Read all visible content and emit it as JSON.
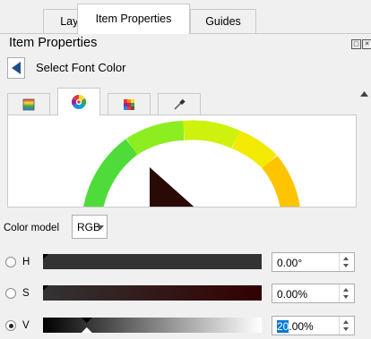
{
  "tabs": [
    {
      "label": "Layout"
    },
    {
      "label": "Item Properties"
    },
    {
      "label": "Guides"
    }
  ],
  "panel": {
    "title": "Item Properties",
    "subtitle": "Select Font Color",
    "back_icon": "back-arrow-icon",
    "dock_icons": [
      "float-icon",
      "close-icon"
    ]
  },
  "picker_tabs": [
    {
      "icon": "color-ramp-icon"
    },
    {
      "icon": "color-wheel-icon"
    },
    {
      "icon": "color-swatches-icon"
    },
    {
      "icon": "color-sampler-icon"
    }
  ],
  "color_model": {
    "label": "Color model",
    "value": "RGB"
  },
  "channels": [
    {
      "label": "H",
      "value": "0.00°",
      "selected": false,
      "level": 0.0
    },
    {
      "label": "S",
      "value": "0.00%",
      "selected": false,
      "level": 0.0
    },
    {
      "label": "V",
      "value_selected": "20",
      "value_rest": ".00%",
      "selected": true,
      "level": 0.2
    }
  ],
  "colors": {
    "current": "#333333",
    "selection_highlight": "#0078d7"
  }
}
